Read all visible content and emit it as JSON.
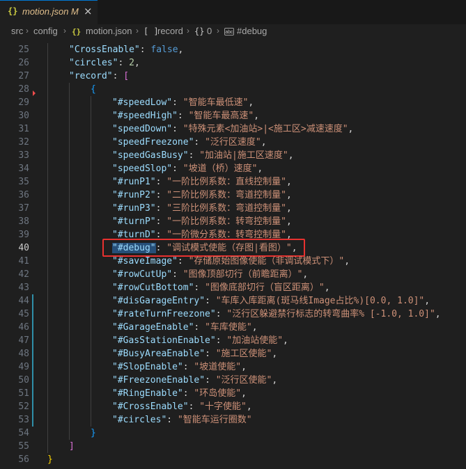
{
  "tab": {
    "icon": "{}",
    "file_name": "motion.json",
    "modified": "M",
    "close": "×"
  },
  "breadcrumb": {
    "src": "src",
    "config": "config",
    "json_icon": "{}",
    "file": "motion.json",
    "array_icon": "[ ]",
    "record": "record",
    "obj_icon": "{}",
    "index": "0",
    "string_icon": "abc",
    "key": "#debug"
  },
  "lines": [
    {
      "n": "25",
      "tokens": [
        [
          "k",
          "\"CrossEnable\""
        ],
        [
          "p",
          ": "
        ],
        [
          "b",
          "false"
        ],
        [
          "p",
          ","
        ]
      ]
    },
    {
      "n": "26",
      "tokens": [
        [
          "k",
          "\"circles\""
        ],
        [
          "p",
          ": "
        ],
        [
          "n",
          "2"
        ],
        [
          "p",
          ","
        ]
      ]
    },
    {
      "n": "27",
      "tokens": [
        [
          "k",
          "\"record\""
        ],
        [
          "p",
          ": "
        ],
        [
          "br2",
          "["
        ]
      ]
    },
    {
      "n": "28",
      "tokens": [
        [
          "br3",
          "{"
        ]
      ]
    },
    {
      "n": "29",
      "tokens": [
        [
          "k",
          "\"#speedLow\""
        ],
        [
          "p",
          ": "
        ],
        [
          "s",
          "\"智能车最低速\""
        ],
        [
          "p",
          ","
        ]
      ]
    },
    {
      "n": "30",
      "tokens": [
        [
          "k",
          "\"#speedHigh\""
        ],
        [
          "p",
          ": "
        ],
        [
          "s",
          "\"智能车最高速\""
        ],
        [
          "p",
          ","
        ]
      ]
    },
    {
      "n": "31",
      "tokens": [
        [
          "k",
          "\"speedDown\""
        ],
        [
          "p",
          ": "
        ],
        [
          "s",
          "\"特殊元素<加油站>|<施工区>减速速度\""
        ],
        [
          "p",
          ","
        ]
      ]
    },
    {
      "n": "32",
      "tokens": [
        [
          "k",
          "\"speedFreezone\""
        ],
        [
          "p",
          ": "
        ],
        [
          "s",
          "\"泛行区速度\""
        ],
        [
          "p",
          ","
        ]
      ]
    },
    {
      "n": "33",
      "tokens": [
        [
          "k",
          "\"speedGasBusy\""
        ],
        [
          "p",
          ": "
        ],
        [
          "s",
          "\"加油站|施工区速度\""
        ],
        [
          "p",
          ","
        ]
      ]
    },
    {
      "n": "34",
      "tokens": [
        [
          "k",
          "\"speedSlop\""
        ],
        [
          "p",
          ": "
        ],
        [
          "s",
          "\"坡道（桥）速度\""
        ],
        [
          "p",
          ","
        ]
      ]
    },
    {
      "n": "35",
      "tokens": [
        [
          "k",
          "\"#runP1\""
        ],
        [
          "p",
          ": "
        ],
        [
          "s",
          "\"一阶比例系数：直线控制量\""
        ],
        [
          "p",
          ","
        ]
      ]
    },
    {
      "n": "36",
      "tokens": [
        [
          "k",
          "\"#runP2\""
        ],
        [
          "p",
          ": "
        ],
        [
          "s",
          "\"二阶比例系数：弯道控制量\""
        ],
        [
          "p",
          ","
        ]
      ]
    },
    {
      "n": "37",
      "tokens": [
        [
          "k",
          "\"#runP3\""
        ],
        [
          "p",
          ": "
        ],
        [
          "s",
          "\"三阶比例系数：弯道控制量\""
        ],
        [
          "p",
          ","
        ]
      ]
    },
    {
      "n": "38",
      "tokens": [
        [
          "k",
          "\"#turnP\""
        ],
        [
          "p",
          ": "
        ],
        [
          "s",
          "\"一阶比例系数：转弯控制量\""
        ],
        [
          "p",
          ","
        ]
      ]
    },
    {
      "n": "39",
      "tokens": [
        [
          "k",
          "\"#turnD\""
        ],
        [
          "p",
          ": "
        ],
        [
          "s",
          "\"一阶微分系数：转弯控制量\""
        ],
        [
          "p",
          ","
        ]
      ]
    },
    {
      "n": "40",
      "tokens": [
        [
          "k",
          "\"#debug\""
        ],
        [
          "p",
          ": "
        ],
        [
          "s",
          "\"调试模式使能（存图|看图）\""
        ],
        [
          "p",
          ","
        ]
      ]
    },
    {
      "n": "41",
      "tokens": [
        [
          "k",
          "\"#saveImage\""
        ],
        [
          "p",
          ": "
        ],
        [
          "s",
          "\"存储原始图像使能（非调试模式下）\""
        ],
        [
          "p",
          ","
        ]
      ]
    },
    {
      "n": "42",
      "tokens": [
        [
          "k",
          "\"#rowCutUp\""
        ],
        [
          "p",
          ": "
        ],
        [
          "s",
          "\"图像顶部切行（前瞻距离）\""
        ],
        [
          "p",
          ","
        ]
      ]
    },
    {
      "n": "43",
      "tokens": [
        [
          "k",
          "\"#rowCutBottom\""
        ],
        [
          "p",
          ": "
        ],
        [
          "s",
          "\"图像底部切行（盲区距离）\""
        ],
        [
          "p",
          ","
        ]
      ]
    },
    {
      "n": "44",
      "tokens": [
        [
          "k",
          "\"#disGarageEntry\""
        ],
        [
          "p",
          ": "
        ],
        [
          "s",
          "\"车库入库距离(斑马线Image占比%)[0.0, 1.0]\""
        ],
        [
          "p",
          ","
        ]
      ]
    },
    {
      "n": "45",
      "tokens": [
        [
          "k",
          "\"#rateTurnFreezone\""
        ],
        [
          "p",
          ": "
        ],
        [
          "s",
          "\"泛行区躲避禁行标志的转弯曲率% [-1.0, 1.0]\""
        ],
        [
          "p",
          ","
        ]
      ]
    },
    {
      "n": "46",
      "tokens": [
        [
          "k",
          "\"#GarageEnable\""
        ],
        [
          "p",
          ": "
        ],
        [
          "s",
          "\"车库使能\""
        ],
        [
          "p",
          ","
        ]
      ]
    },
    {
      "n": "47",
      "tokens": [
        [
          "k",
          "\"#GasStationEnable\""
        ],
        [
          "p",
          ": "
        ],
        [
          "s",
          "\"加油站使能\""
        ],
        [
          "p",
          ","
        ]
      ]
    },
    {
      "n": "48",
      "tokens": [
        [
          "k",
          "\"#BusyAreaEnable\""
        ],
        [
          "p",
          ": "
        ],
        [
          "s",
          "\"施工区使能\""
        ],
        [
          "p",
          ","
        ]
      ]
    },
    {
      "n": "49",
      "tokens": [
        [
          "k",
          "\"#SlopEnable\""
        ],
        [
          "p",
          ": "
        ],
        [
          "s",
          "\"坡道使能\""
        ],
        [
          "p",
          ","
        ]
      ]
    },
    {
      "n": "50",
      "tokens": [
        [
          "k",
          "\"#FreezoneEnable\""
        ],
        [
          "p",
          ": "
        ],
        [
          "s",
          "\"泛行区使能\""
        ],
        [
          "p",
          ","
        ]
      ]
    },
    {
      "n": "51",
      "tokens": [
        [
          "k",
          "\"#RingEnable\""
        ],
        [
          "p",
          ": "
        ],
        [
          "s",
          "\"环岛使能\""
        ],
        [
          "p",
          ","
        ]
      ]
    },
    {
      "n": "52",
      "tokens": [
        [
          "k",
          "\"#CrossEnable\""
        ],
        [
          "p",
          ": "
        ],
        [
          "s",
          "\"十字使能\""
        ],
        [
          "p",
          ","
        ]
      ]
    },
    {
      "n": "53",
      "tokens": [
        [
          "k",
          "\"#circles\""
        ],
        [
          "p",
          ": "
        ],
        [
          "s",
          "\"智能车运行圈数\""
        ]
      ]
    },
    {
      "n": "54",
      "tokens": [
        [
          "br3",
          "}"
        ]
      ]
    },
    {
      "n": "55",
      "tokens": [
        [
          "br2",
          "]"
        ]
      ]
    },
    {
      "n": "56",
      "tokens": [
        [
          "br1",
          "}"
        ]
      ]
    }
  ],
  "indent_levels": {
    "25": 1,
    "26": 1,
    "27": 1,
    "28": 2,
    "29": 3,
    "30": 3,
    "31": 3,
    "32": 3,
    "33": 3,
    "34": 3,
    "35": 3,
    "36": 3,
    "37": 3,
    "38": 3,
    "39": 3,
    "40": 3,
    "41": 3,
    "42": 3,
    "43": 3,
    "44": 3,
    "45": 3,
    "46": 3,
    "47": 3,
    "48": 3,
    "49": 3,
    "50": 3,
    "51": 3,
    "52": 3,
    "53": 3,
    "54": 2,
    "55": 1,
    "56": 0
  },
  "active_line": "40",
  "colors": {
    "key": "#9cdcfe",
    "string": "#ce9178",
    "number": "#b5cea8",
    "boolean": "#569cd6",
    "highlight_box": "#e8312f",
    "selection": "#264f78"
  }
}
